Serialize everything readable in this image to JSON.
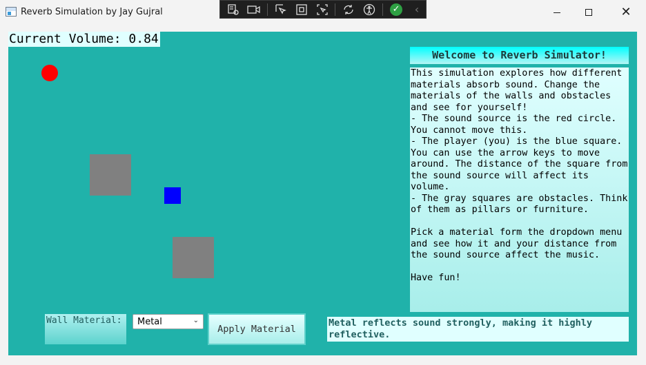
{
  "window": {
    "title": "Reverb Simulation by Jay Gujral",
    "minimize_glyph": "",
    "close_glyph": "✕"
  },
  "debug_toolbar": {
    "icons": [
      "select-element-icon",
      "video-icon",
      "pointer-icon",
      "frame-icon",
      "adorner-icon",
      "hot-reload-icon",
      "accessibility-icon",
      "checkmark-icon",
      "collapse-icon"
    ],
    "check_glyph": "✓",
    "collapse_glyph": "‹"
  },
  "app": {
    "volume_text": "Current Volume: 0.84",
    "welcome_title": "Welcome to Reverb Simulator!",
    "instructions": "This simulation explores how different materials absorb sound. Change the materials of the walls and obstacles and see for yourself!\n- The sound source is the red circle. You cannot move this.\n- The player (you) is the blue square. You can use the arrow keys to move around. The distance of the square from the sound source will affect its volume.\n- The gray squares are obstacles. Think of them as pillars or furniture.\n\nPick a material form the dropdown menu and see how it and your distance from the sound source affect the music.\n\nHave fun!",
    "wall_material_label": "Wall Material:",
    "material_selected": "Metal",
    "apply_button": "Apply Material",
    "material_description": "Metal reflects sound strongly, making it highly reflective."
  },
  "colors": {
    "background": "#20b2aa",
    "sound_source": "#ff0000",
    "player": "#0000ff",
    "obstacle": "#808080",
    "panel_light": "#e0ffff"
  }
}
